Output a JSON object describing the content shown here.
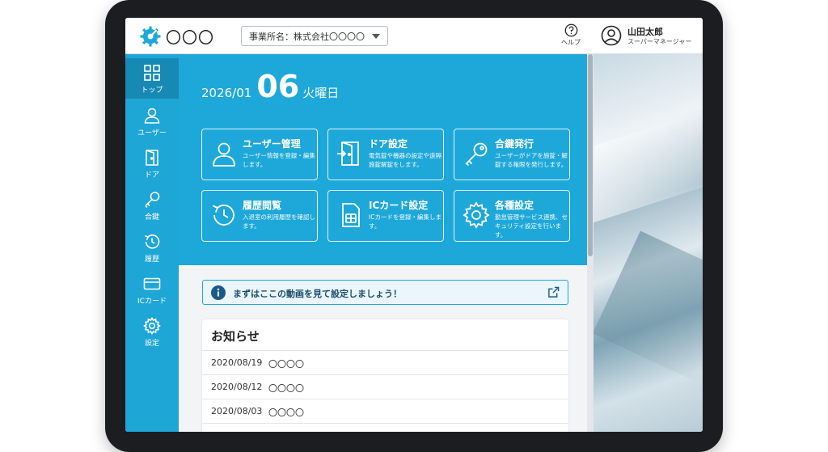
{
  "header": {
    "logo_text": "〇〇〇",
    "office_label": "事業所名：株式会社〇〇〇〇",
    "help_label": "ヘルプ",
    "user_name": "山田太郎",
    "user_role": "スーパーマネージャー"
  },
  "sidebar": {
    "items": [
      {
        "label": "トップ",
        "icon": "grid-icon",
        "active": true
      },
      {
        "label": "ユーザー",
        "icon": "user-icon"
      },
      {
        "label": "ドア",
        "icon": "door-icon"
      },
      {
        "label": "合鍵",
        "icon": "key-icon"
      },
      {
        "label": "履歴",
        "icon": "history-icon"
      },
      {
        "label": "ICカード",
        "icon": "card-icon"
      },
      {
        "label": "設定",
        "icon": "gear-icon"
      }
    ]
  },
  "date": {
    "year_month": "2026/01",
    "day": "06",
    "weekday": "火曜日"
  },
  "tiles": [
    {
      "title": "ユーザー管理",
      "desc": "ユーザー情報を登録・編集します。",
      "icon": "user-icon"
    },
    {
      "title": "ドア設定",
      "desc": "電気錠や機器の設定や遠隔施錠解錠をします。",
      "icon": "door-icon"
    },
    {
      "title": "合鍵発行",
      "desc": "ユーザーがドアを施錠・解錠する権限を発行します。",
      "icon": "key-icon"
    },
    {
      "title": "履歴閲覧",
      "desc": "入退室の利用履歴を確認します。",
      "icon": "history-icon"
    },
    {
      "title": "ICカード設定",
      "desc": "ICカードを登録・編集します。",
      "icon": "sim-card-icon"
    },
    {
      "title": "各種設定",
      "desc": "勤怠管理サービス連携、セキュリティ設定を行います。",
      "icon": "gear-icon"
    }
  ],
  "notice_bar": {
    "text": "まずはここの動画を見て設定しましょう！"
  },
  "news": {
    "title": "お知らせ",
    "items": [
      {
        "date": "2020/08/19",
        "text": "〇〇〇〇"
      },
      {
        "date": "2020/08/12",
        "text": "〇〇〇〇"
      },
      {
        "date": "2020/08/03",
        "text": "〇〇〇〇"
      }
    ]
  },
  "colors": {
    "accent": "#1ea8da",
    "sidebar": "#1ea6d6",
    "sidebar_active": "#1789b5"
  }
}
